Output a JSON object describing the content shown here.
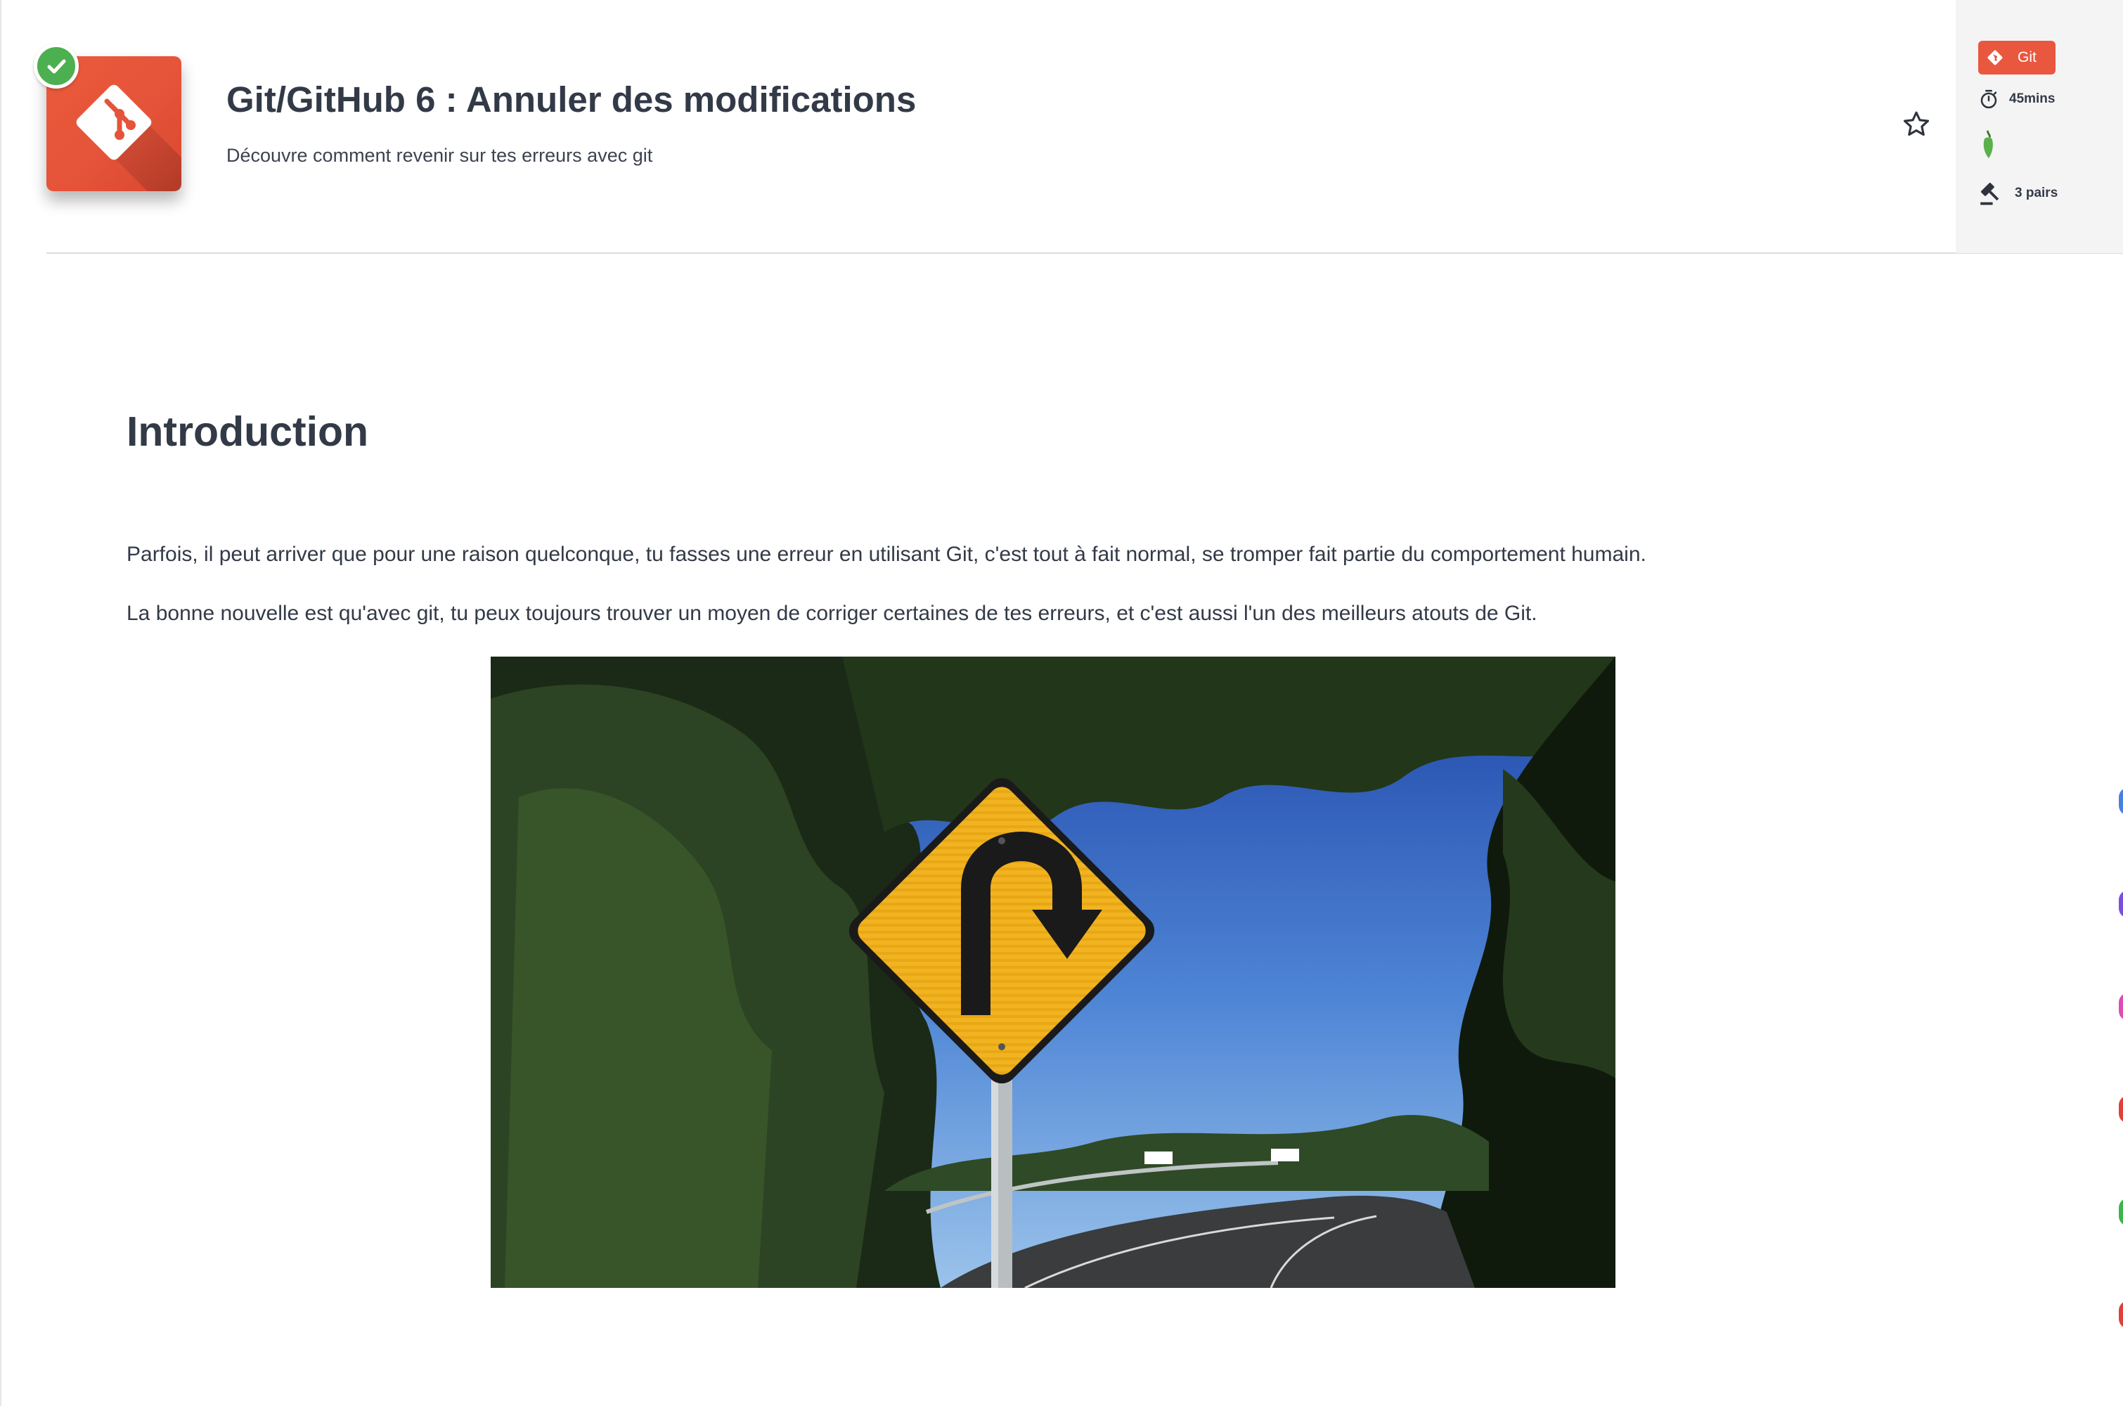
{
  "header": {
    "title": "Git/GitHub 6 : Annuler des modifications",
    "subtitle": "Découvre comment revenir sur tes erreurs avec git",
    "logo_icon": "git-logo-icon",
    "completed_icon": "check-icon",
    "favorite_icon": "star-outline-icon"
  },
  "meta": {
    "tag_label": "Git",
    "tag_icon": "git-icon",
    "duration": "45mins",
    "duration_icon": "stopwatch-icon",
    "level_icon": "pepper-icon",
    "pairs": "3 pairs",
    "pairs_icon": "gavel-icon"
  },
  "content": {
    "heading": "Introduction",
    "paragraphs": [
      "Parfois, il peut arriver que pour une raison quelconque, tu fasses une erreur en utilisant Git, c'est tout à fait normal, se tromper fait partie du comportement humain.",
      "La bonne nouvelle est qu'avec git, tu peux toujours trouver un moyen de corriger certaines de tes erreurs, et c'est aussi l'un des meilleurs atouts de Git."
    ],
    "image_subject": "u-turn-road-sign-photo"
  },
  "colors": {
    "brand_orange": "#e9573f",
    "success_green": "#4caf50",
    "text_dark": "#333a47",
    "panel_bg": "#f4f4f4",
    "edge_blue": "#4a7fe0",
    "edge_purple": "#7b4ee0",
    "edge_pink": "#e04ab4",
    "edge_red": "#e0403a",
    "edge_green": "#3cb54a"
  }
}
